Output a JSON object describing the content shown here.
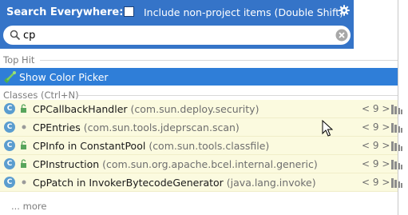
{
  "header": {
    "title": "Search Everywhere:",
    "checkbox_label": "Include non-project items (Double Shift)",
    "checkbox_checked": false,
    "gear_icon": "gear-icon"
  },
  "search": {
    "value": "cp",
    "search_icon": "search-icon",
    "clear_icon": "clear-icon"
  },
  "top_hit": {
    "section_title": "Top Hit",
    "item": {
      "label": "Show Color Picker",
      "icon": "color-picker-icon"
    }
  },
  "classes": {
    "section_title": "Classes (Ctrl+N)",
    "items": [
      {
        "name": "CPCallbackHandler",
        "package": "(com.sun.deploy.security)",
        "jdk": "< 9 >"
      },
      {
        "name": "CPEntries",
        "package": "(com.sun.tools.jdeprscan.scan)",
        "jdk": "< 9 >"
      },
      {
        "name": "CPInfo in ConstantPool",
        "package": "(com.sun.tools.classfile)",
        "jdk": "< 9 >"
      },
      {
        "name": "CPInstruction",
        "package": "(com.sun.org.apache.bcel.internal.generic)",
        "jdk": "< 9 >"
      },
      {
        "name": "CpPatch in InvokerBytecodeGenerator",
        "package": "(java.lang.invoke)",
        "jdk": "< 9 >"
      }
    ],
    "more_label": "... more"
  },
  "colors": {
    "header_bg": "#3574c8",
    "selection_bg": "#2f7ed8",
    "row_bg": "#fbfadf",
    "class_icon": "#5b9dcf"
  }
}
